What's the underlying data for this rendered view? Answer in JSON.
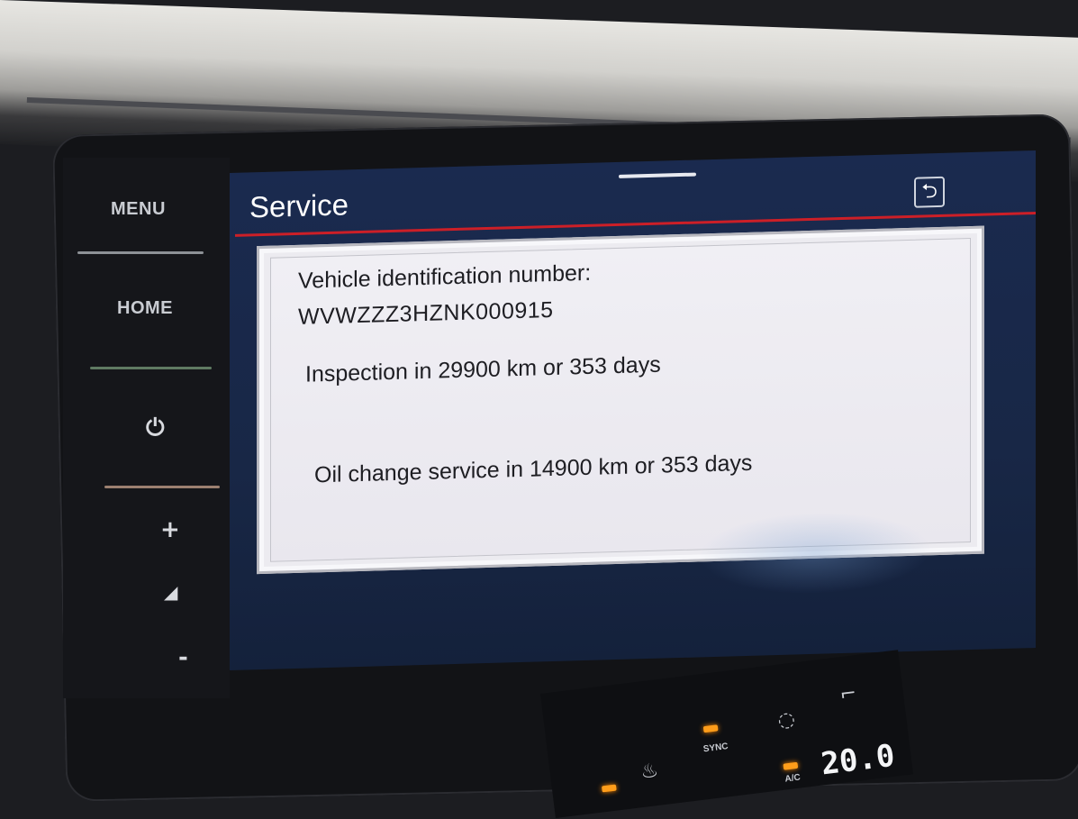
{
  "side_buttons": {
    "menu": "MENU",
    "home": "HOME",
    "power_icon": "power-icon",
    "volume_up": "+",
    "volume_icon": "volume-icon",
    "volume_down": "-"
  },
  "screen": {
    "title": "Service",
    "back_icon": "back-arrow-icon",
    "colors": {
      "title_bar": "#1a2a4f",
      "accent_line": "#cc1f27",
      "panel": "#ecebf0"
    }
  },
  "service_info": {
    "vin_label": "Vehicle identification number:",
    "vin_value": "WVWZZZ3HZNK000915",
    "inspection": "Inspection in 29900 km or 353 days",
    "oil_change": "Oil change service in 14900 km or 353 days"
  },
  "climate": {
    "sync_label": "SYNC",
    "ac_label": "A/C",
    "temperature": "20.0",
    "seat_heat_icon": "seat-heat-icon",
    "recirculation_icon": "recirculation-icon",
    "seat_icon": "seat-icon"
  }
}
